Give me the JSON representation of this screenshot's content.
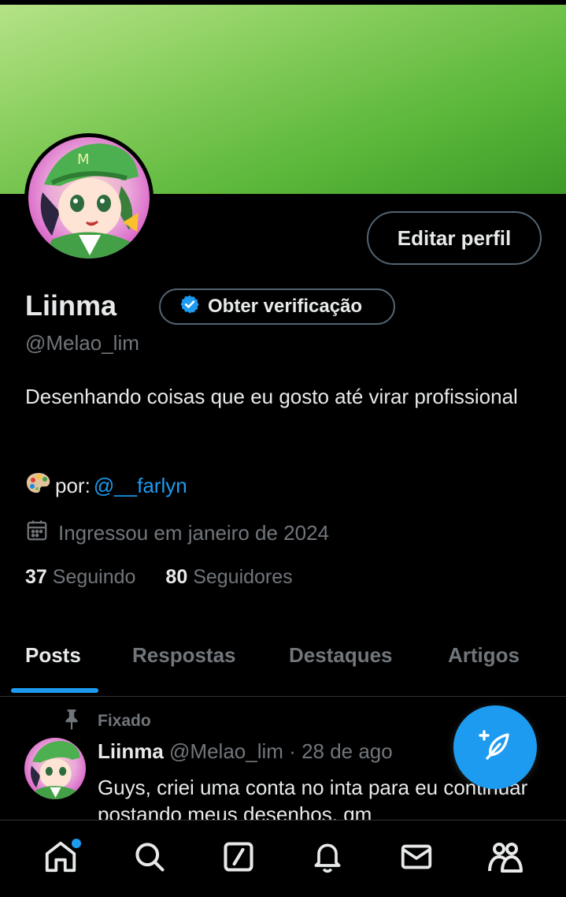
{
  "profile": {
    "name": "Liinma",
    "handle": "@Melao_lim",
    "edit_label": "Editar perfil",
    "verify_label": "Obter verificação",
    "bio": "Desenhando coisas que eu gosto até virar profissional",
    "credit_prefix": "por:",
    "credit_link": "@__farlyn",
    "joined": "Ingressou em janeiro de 2024",
    "following_count": "37",
    "following_label": "Seguindo",
    "followers_count": "80",
    "followers_label": "Seguidores"
  },
  "tabs": [
    {
      "label": "Posts"
    },
    {
      "label": "Respostas"
    },
    {
      "label": "Destaques"
    },
    {
      "label": "Artigos"
    }
  ],
  "post": {
    "pinned_label": "Fixado",
    "author": "Liinma",
    "handle": "@Melao_lim",
    "separator": "·",
    "date": "28 de ago",
    "text": "Guys, criei uma conta no inta para eu continuar postando meus desenhos, qm"
  },
  "nav": [
    "home-icon",
    "search-icon",
    "grok-icon",
    "notifications-icon",
    "messages-icon",
    "communities-icon"
  ],
  "colors": {
    "accent": "#1d9bf0",
    "banner": "#6cc44a"
  }
}
